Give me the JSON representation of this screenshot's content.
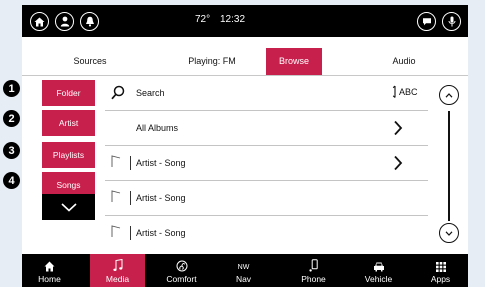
{
  "status": {
    "temperature": "72°",
    "time": "12:32"
  },
  "tabs": [
    {
      "label": "Sources",
      "active": false
    },
    {
      "label": "Playing: FM",
      "active": false
    },
    {
      "label": "Browse",
      "active": true
    },
    {
      "label": "Audio",
      "active": false
    }
  ],
  "categories": [
    {
      "badge": "1",
      "label": "Folder"
    },
    {
      "badge": "2",
      "label": "Artist"
    },
    {
      "badge": "3",
      "label": "Playlists"
    },
    {
      "badge": "4",
      "label": "Songs"
    }
  ],
  "list": {
    "search_label": "Search",
    "abc_label": "ABC",
    "rows": [
      {
        "label": "All Albums"
      },
      {
        "label": "Artist - Song"
      },
      {
        "label": "Artist - Song"
      },
      {
        "label": "Artist - Song"
      }
    ]
  },
  "nav": [
    {
      "label": "Home",
      "icon": "home-icon",
      "active": false
    },
    {
      "label": "Media",
      "icon": "music-note-icon",
      "active": true
    },
    {
      "label": "Comfort",
      "icon": "climate-icon",
      "active": false
    },
    {
      "label": "Nav",
      "icon": "compass-icon",
      "active": false,
      "icon_text": "NW"
    },
    {
      "label": "Phone",
      "icon": "phone-icon",
      "active": false
    },
    {
      "label": "Vehicle",
      "icon": "car-icon",
      "active": false
    },
    {
      "label": "Apps",
      "icon": "apps-grid-icon",
      "active": false
    }
  ],
  "colors": {
    "accent": "#c8204c",
    "bar_background": "#000000"
  }
}
